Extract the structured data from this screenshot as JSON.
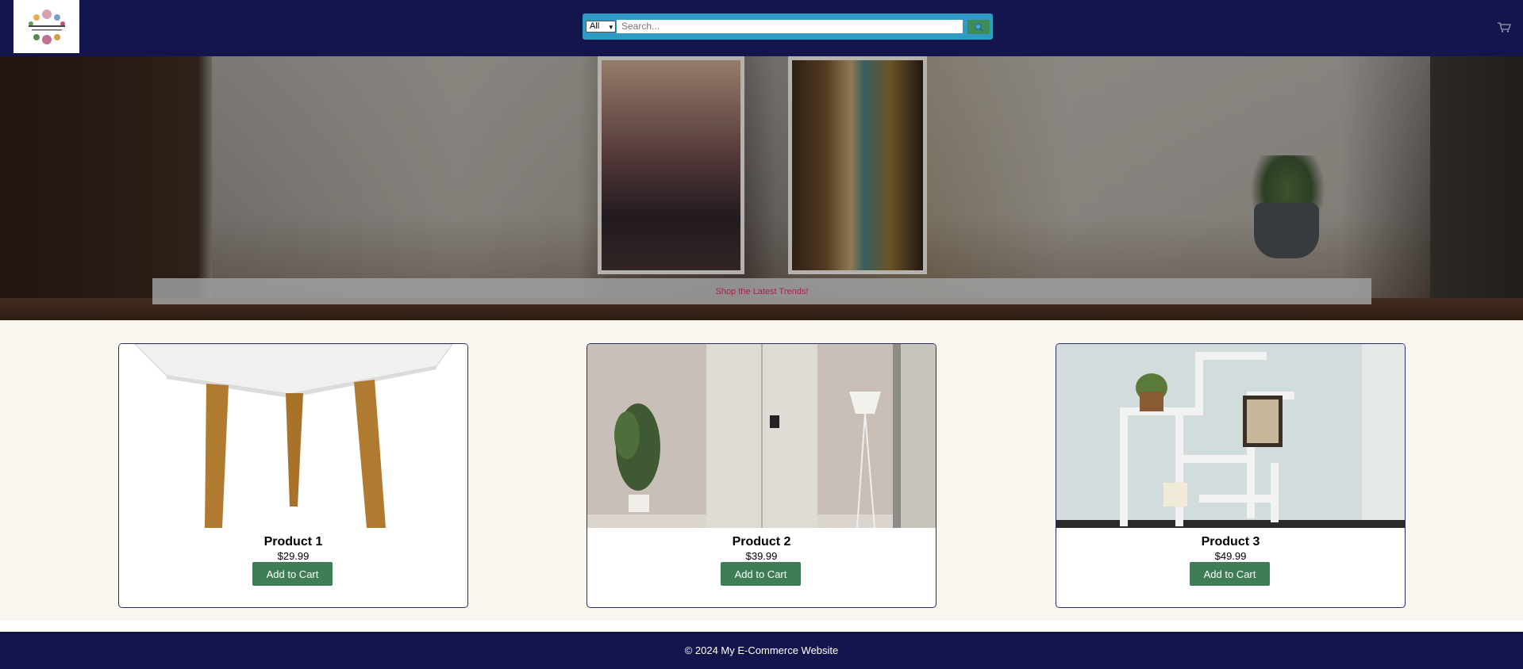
{
  "header": {
    "logo": "logo",
    "search": {
      "category": "All",
      "placeholder": "Search...",
      "button_icon": "search-icon"
    },
    "cart_icon": "cart-icon"
  },
  "hero": {
    "banner_text": "Shop the Latest Trends!"
  },
  "products": [
    {
      "name": "Product 1",
      "price": "$29.99",
      "button": "Add to Cart"
    },
    {
      "name": "Product 2",
      "price": "$39.99",
      "button": "Add to Cart"
    },
    {
      "name": "Product 3",
      "price": "$49.99",
      "button": "Add to Cart"
    }
  ],
  "footer": {
    "text": "© 2024 My E-Commerce Website"
  },
  "colors": {
    "header_bg": "#15154e",
    "search_bg": "#2f9ac4",
    "button_green": "#3f7d56",
    "banner_text": "#a8204a",
    "page_bg": "#f9f6ef"
  }
}
